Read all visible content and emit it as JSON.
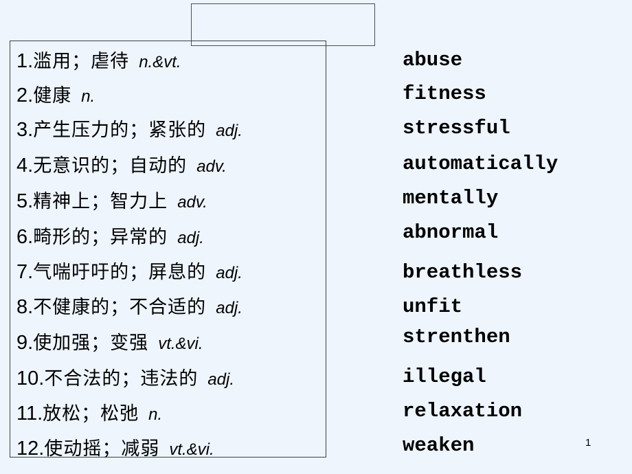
{
  "slide": {
    "page_number": "1",
    "title_box_text": ""
  },
  "vocabulary": [
    {
      "num": "1.",
      "cn": "滥用；虐待",
      "pos": "n.&vt.",
      "en": "abuse"
    },
    {
      "num": "2.",
      "cn": "健康",
      "pos": "n.",
      "en": "fitness"
    },
    {
      "num": "3.",
      "cn": "产生压力的；紧张的",
      "pos": "adj.",
      "en": "stressful"
    },
    {
      "num": "4.",
      "cn": "无意识的；自动的",
      "pos": "adv.",
      "en": "automatically"
    },
    {
      "num": "5.",
      "cn": "精神上；智力上",
      "pos": "adv.",
      "en": "mentally"
    },
    {
      "num": "6.",
      "cn": "畸形的；异常的",
      "pos": "adj.",
      "en": "abnormal"
    },
    {
      "num": "7.",
      "cn": "气喘吁吁的；屏息的",
      "pos": "adj.",
      "en": "breathless"
    },
    {
      "num": "8.",
      "cn": "不健康的；不合适的",
      "pos": "adj.",
      "en": "unfit"
    },
    {
      "num": "9.",
      "cn": "使加强；变强",
      "pos": "vt.&vi.",
      "en": "strenthen"
    },
    {
      "num": "10.",
      "cn": "不合法的；违法的",
      "pos": "adj.",
      "en": "illegal"
    },
    {
      "num": "11.",
      "cn": "放松；松弛",
      "pos": "n.",
      "en": "relaxation"
    },
    {
      "num": "12.",
      "cn": "使动摇；减弱",
      "pos": "vt.&vi.",
      "en": "weaken"
    }
  ]
}
